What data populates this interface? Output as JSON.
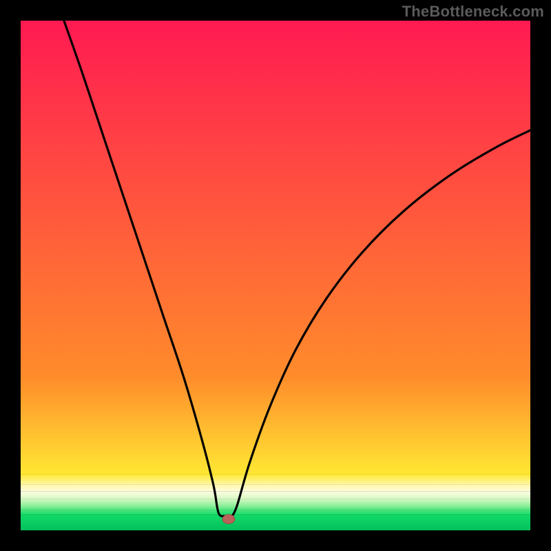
{
  "watermark": "TheBottleneck.com",
  "chart_data": {
    "type": "line",
    "title": "",
    "xlabel": "",
    "ylabel": "",
    "x_range": [
      0,
      1
    ],
    "y_range": [
      0,
      1
    ],
    "curve_min_x": 0.4,
    "curve_min_y": 0.028,
    "left_branch": [
      {
        "x": 0.085,
        "y": 1.0
      },
      {
        "x": 0.12,
        "y": 0.9
      },
      {
        "x": 0.16,
        "y": 0.78
      },
      {
        "x": 0.2,
        "y": 0.66
      },
      {
        "x": 0.24,
        "y": 0.54
      },
      {
        "x": 0.28,
        "y": 0.42
      },
      {
        "x": 0.32,
        "y": 0.3
      },
      {
        "x": 0.355,
        "y": 0.18
      },
      {
        "x": 0.378,
        "y": 0.09
      },
      {
        "x": 0.388,
        "y": 0.035
      },
      {
        "x": 0.4,
        "y": 0.028
      }
    ],
    "right_branch": [
      {
        "x": 0.415,
        "y": 0.028
      },
      {
        "x": 0.425,
        "y": 0.05
      },
      {
        "x": 0.45,
        "y": 0.135
      },
      {
        "x": 0.49,
        "y": 0.245
      },
      {
        "x": 0.54,
        "y": 0.355
      },
      {
        "x": 0.6,
        "y": 0.455
      },
      {
        "x": 0.67,
        "y": 0.545
      },
      {
        "x": 0.75,
        "y": 0.625
      },
      {
        "x": 0.84,
        "y": 0.695
      },
      {
        "x": 0.93,
        "y": 0.75
      },
      {
        "x": 1.0,
        "y": 0.785
      }
    ],
    "marker": {
      "x": 0.408,
      "y": 0.022,
      "rx": 0.012,
      "ry": 0.009
    },
    "bands": [
      {
        "y0": 1.0,
        "y1": 0.3,
        "c0": "#ff1a51",
        "c1": "#ff8c2b"
      },
      {
        "y0": 0.3,
        "y1": 0.11,
        "c0": "#ff8c2b",
        "c1": "#ffe733"
      },
      {
        "y0": 0.11,
        "y1": 0.09,
        "c0": "#ffe733",
        "c1": "#fff7a6"
      },
      {
        "y0": 0.09,
        "y1": 0.076,
        "c0": "#fff7a6",
        "c1": "#fdfde0"
      },
      {
        "y0": 0.076,
        "y1": 0.062,
        "c0": "#fdfde0",
        "c1": "#d7f9c4"
      },
      {
        "y0": 0.062,
        "y1": 0.05,
        "c0": "#d7f9c4",
        "c1": "#98f0a0"
      },
      {
        "y0": 0.05,
        "y1": 0.04,
        "c0": "#98f0a0",
        "c1": "#4fe77e"
      },
      {
        "y0": 0.04,
        "y1": 0.03,
        "c0": "#4fe77e",
        "c1": "#12d968"
      },
      {
        "y0": 0.03,
        "y1": 0.0,
        "c0": "#12d968",
        "c1": "#02c05c"
      }
    ]
  }
}
